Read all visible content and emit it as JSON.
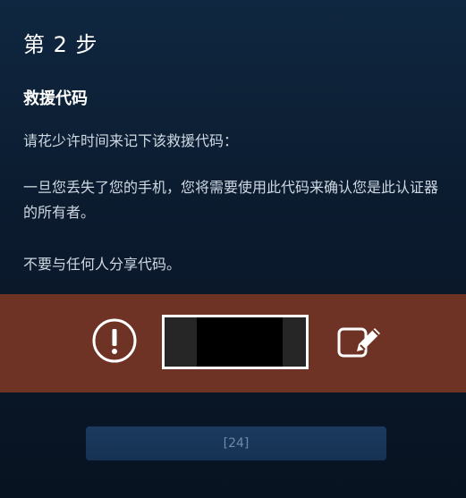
{
  "step": {
    "title": "第 2 步"
  },
  "section": {
    "title": "救援代码",
    "instruction": "请花少许时间来记下该救援代码：",
    "warning_line_1": "一旦您丢失了您的手机，您将需要使用此代码来确认您是此认证器的所有者。",
    "warning_line_2": "不要与任何人分享代码。"
  },
  "code_panel": {
    "alert_icon": "exclamation-circle-icon",
    "code_value": "",
    "edit_icon": "edit-icon",
    "band_color": "#6e3325"
  },
  "footer": {
    "button_label": "[24]"
  }
}
